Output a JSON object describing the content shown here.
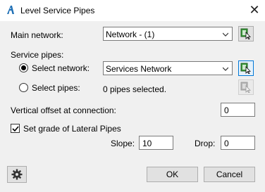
{
  "window": {
    "title": "Level Service Pipes",
    "close_glyph": "✕"
  },
  "main_network": {
    "label": "Main network:",
    "selected": "Network - (1)"
  },
  "service_pipes": {
    "section_label": "Service pipes:",
    "select_network": {
      "label": "Select network:",
      "checked": true,
      "selected": "Services Network"
    },
    "select_pipes": {
      "label": "Select pipes:",
      "checked": false,
      "status": "0 pipes selected."
    }
  },
  "vertical_offset": {
    "label": "Vertical offset at connection:",
    "value": "0"
  },
  "lateral_grade": {
    "label": "Set grade of Lateral Pipes",
    "checked": true,
    "slope_label": "Slope:",
    "slope_value": "10",
    "drop_label": "Drop:",
    "drop_value": "0"
  },
  "buttons": {
    "ok": "OK",
    "cancel": "Cancel"
  },
  "icons": {
    "app": "autocad-a-icon",
    "pick": "pick-from-drawing-icon",
    "settings": "gear-icon",
    "accent": "#0078d7",
    "pick_green": "#3c9a3c"
  }
}
